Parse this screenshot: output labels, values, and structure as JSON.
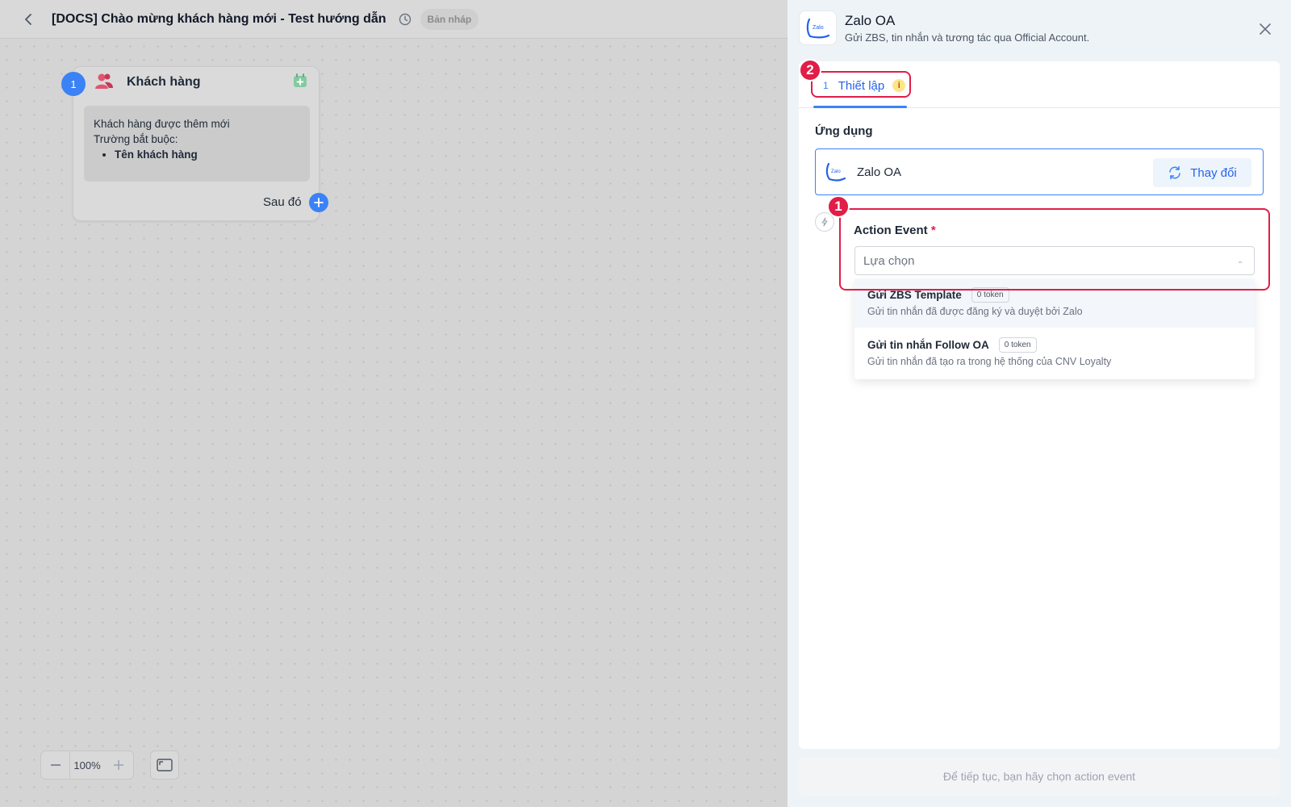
{
  "header": {
    "title": "[DOCS] Chào mừng khách hàng mới - Test hướng dẫn",
    "badge": "Bản nháp"
  },
  "canvas": {
    "node": {
      "step": "1",
      "title": "Khách hàng",
      "line1": "Khách hàng được thêm mới",
      "line2": "Trường bắt buộc:",
      "required_field": "Tên khách hàng",
      "then_label": "Sau đó"
    },
    "zoom": "100%"
  },
  "panel": {
    "app_name": "Zalo OA",
    "app_desc": "Gửi ZBS, tin nhắn và tương tác qua Official Account.",
    "logo_text": "Zalo",
    "tab": {
      "num": "1",
      "label": "Thiết lập",
      "info": "i"
    },
    "section_label": "Ứng dụng",
    "app_box_name": "Zalo OA",
    "change_label": "Thay đổi",
    "event_label": "Action Event",
    "event_required": "*",
    "select_placeholder": "Lựa chọn",
    "options": [
      {
        "title": "Gửi ZBS Template",
        "badge": "0 token",
        "desc": "Gửi tin nhắn đã được đăng ký và duyệt bởi Zalo"
      },
      {
        "title": "Gửi tin nhắn Follow OA",
        "badge": "0 token",
        "desc": "Gửi tin nhắn đã tạo ra trong hệ thống của CNV Loyalty"
      }
    ],
    "footer_text": "Để tiếp tục, bạn hãy chọn action event"
  },
  "annotations": {
    "one": "1",
    "two": "2"
  },
  "colors": {
    "accent": "#3b82f6",
    "highlight": "#e11d48"
  }
}
